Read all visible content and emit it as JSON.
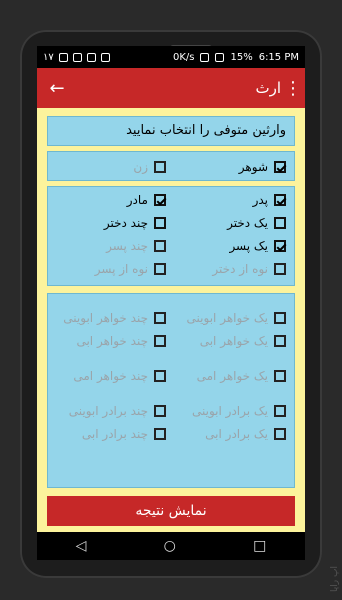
{
  "status": {
    "left_text": "۱۷",
    "speed": "0K/s",
    "battery": "15%",
    "time": "6:15 PM"
  },
  "appbar": {
    "title": "ارث",
    "back_icon": "arrow-left-icon",
    "menu_icon": "more-vert-icon"
  },
  "prompt": "وارثین متوفی را انتخاب نمایید",
  "spouse": [
    {
      "label": "شوهر",
      "checked": true,
      "disabled": false
    },
    {
      "label": "زن",
      "checked": false,
      "disabled": true
    }
  ],
  "family_right": [
    {
      "label": "پدر",
      "checked": true,
      "disabled": false
    },
    {
      "label": "یک دختر",
      "checked": false,
      "disabled": false
    },
    {
      "label": "یک پسر",
      "checked": true,
      "disabled": false
    },
    {
      "label": "نوه از دختر",
      "checked": false,
      "disabled": true
    }
  ],
  "family_left": [
    {
      "label": "مادر",
      "checked": true,
      "disabled": false
    },
    {
      "label": "چند دختر",
      "checked": false,
      "disabled": false
    },
    {
      "label": "چند پسر",
      "checked": false,
      "disabled": true
    },
    {
      "label": "نوه از پسر",
      "checked": false,
      "disabled": true
    }
  ],
  "siblings_right": [
    {
      "label": "یک خواهر ابوینی",
      "checked": false,
      "disabled": true
    },
    {
      "label": "یک خواهر ابی",
      "checked": false,
      "disabled": true
    },
    {
      "label": "یک خواهر امی",
      "checked": false,
      "disabled": true
    },
    {
      "label": "یک برادر ابوینی",
      "checked": false,
      "disabled": true
    },
    {
      "label": "یک برادر ابی",
      "checked": false,
      "disabled": true
    }
  ],
  "siblings_left": [
    {
      "label": "چند خواهر ابوینی",
      "checked": false,
      "disabled": true
    },
    {
      "label": "چند خواهر ابی",
      "checked": false,
      "disabled": true
    },
    {
      "label": "چند خواهر امی",
      "checked": false,
      "disabled": true
    },
    {
      "label": "چند برادر ابوینی",
      "checked": false,
      "disabled": true
    },
    {
      "label": "چند برادر ابی",
      "checked": false,
      "disabled": true
    }
  ],
  "result_button": "نمایش نتیجه",
  "watermark": "اپ راپا"
}
